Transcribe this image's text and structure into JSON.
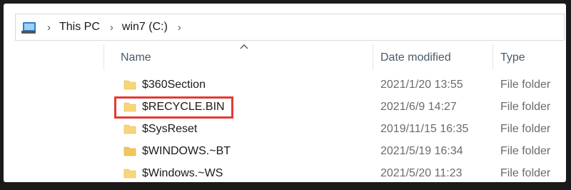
{
  "address_bar": {
    "icon": "this-pc-icon",
    "breadcrumbs": [
      "This PC",
      "win7 (C:)"
    ]
  },
  "columns": {
    "name": "Name",
    "date": "Date modified",
    "type": "Type"
  },
  "rows": [
    {
      "name": "$360Section",
      "date": "2021/1/20 13:55",
      "type": "File folder",
      "highlighted": false
    },
    {
      "name": "$RECYCLE.BIN",
      "date": "2021/6/9 14:27",
      "type": "File folder",
      "highlighted": true
    },
    {
      "name": "$SysReset",
      "date": "2019/11/15 16:35",
      "type": "File folder",
      "highlighted": false
    },
    {
      "name": "$WINDOWS.~BT",
      "date": "2021/5/19 16:34",
      "type": "File folder",
      "highlighted": false
    },
    {
      "name": "$Windows.~WS",
      "date": "2021/5/20 11:23",
      "type": "File folder",
      "highlighted": false
    }
  ],
  "colors": {
    "highlight": "#e53935",
    "folder": "#f6d67a"
  }
}
